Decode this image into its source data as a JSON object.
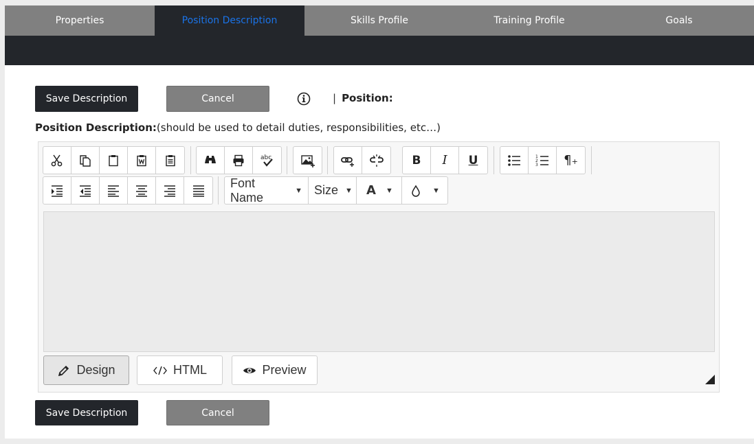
{
  "tabs": [
    {
      "label": "Properties",
      "active": false
    },
    {
      "label": "Position Description",
      "active": true
    },
    {
      "label": "Skills Profile",
      "active": false
    },
    {
      "label": "Training Profile",
      "active": false
    },
    {
      "label": "Goals",
      "active": false
    }
  ],
  "actions": {
    "save_label": "Save Description",
    "cancel_label": "Cancel"
  },
  "position": {
    "separator": "|",
    "label": "Position:"
  },
  "description": {
    "label": "Position Description:",
    "hint": "(should be used to detail duties, responsibilities, etc…)"
  },
  "toolbar": {
    "font_name": "Font Name",
    "size": "Size",
    "font_color_glyph": "A",
    "dropdown_caret": "▼"
  },
  "modes": {
    "design": "Design",
    "html": "HTML",
    "preview": "Preview"
  },
  "colors": {
    "tab_bg": "#808080",
    "dark": "#23262b",
    "active_tab_text": "#1a73e8"
  }
}
